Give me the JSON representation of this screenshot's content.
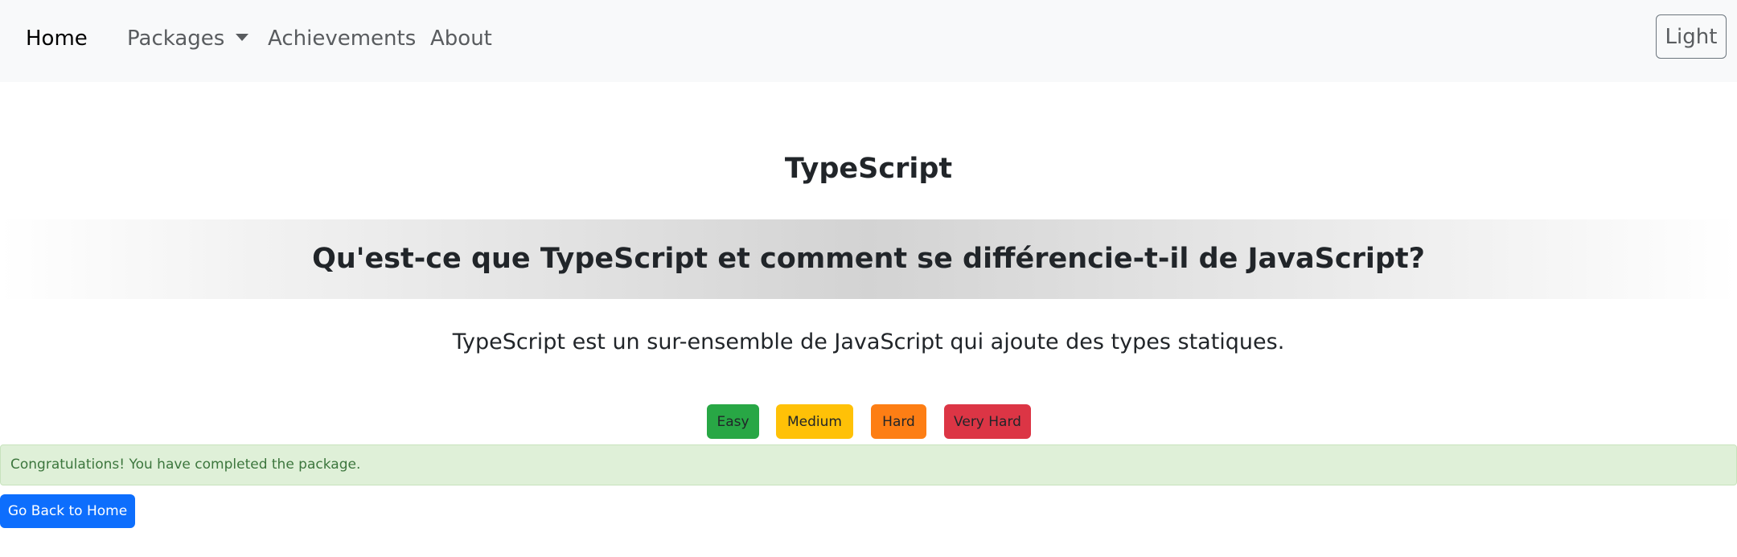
{
  "navbar": {
    "brand": "Home",
    "items": [
      {
        "label": "Packages",
        "has_dropdown": true
      },
      {
        "label": "Achievements"
      },
      {
        "label": "About"
      }
    ],
    "theme_toggle_label": "Light"
  },
  "package": {
    "title": "TypeScript"
  },
  "card": {
    "question": "Qu'est-ce que TypeScript et comment se différencie-t-il de JavaScript?",
    "answer": "TypeScript est un sur-ensemble de JavaScript qui ajoute des types statiques."
  },
  "difficulty_buttons": [
    {
      "label": "Easy",
      "color": "#28a745"
    },
    {
      "label": "Medium",
      "color": "#ffc107"
    },
    {
      "label": "Hard",
      "color": "#fd7e14"
    },
    {
      "label": "Very Hard",
      "color": "#dc3545"
    }
  ],
  "alert": {
    "message": "Congratulations! You have completed the package.",
    "background": "#dff0d8"
  },
  "home_button": {
    "label": "Go Back to Home",
    "color": "#0d6efd"
  },
  "icons": {
    "dropdown": "caret-down-icon"
  }
}
